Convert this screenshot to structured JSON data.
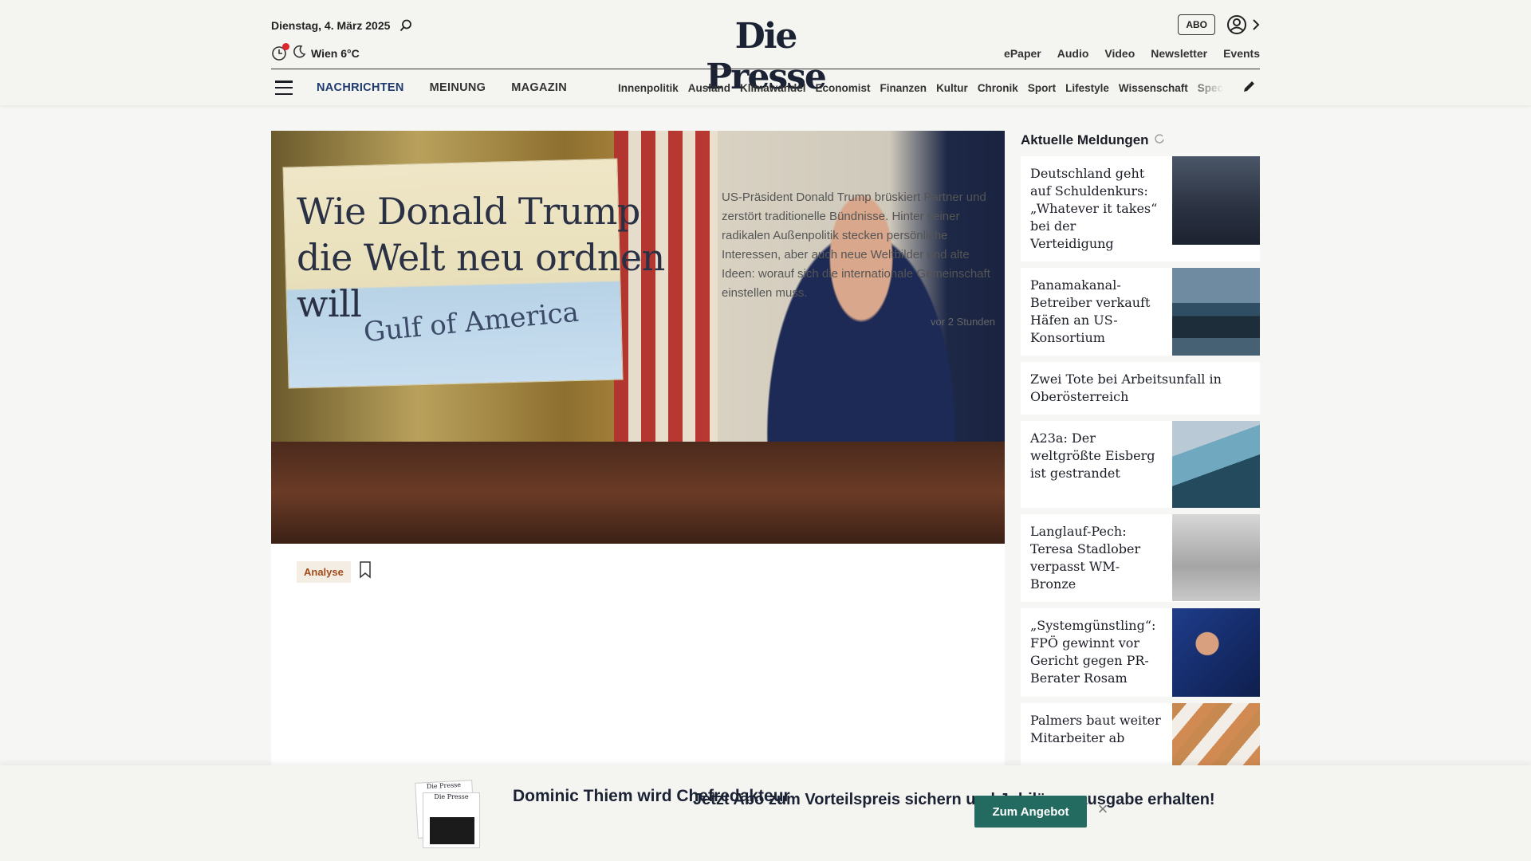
{
  "header": {
    "date": "Dienstag, 4. März 2025",
    "weather": "Wien 6°C",
    "logo": "Die Presse",
    "abo": "ABO",
    "links": [
      "ePaper",
      "Audio",
      "Video",
      "Newsletter",
      "Events"
    ]
  },
  "nav": {
    "main": [
      "NACHRICHTEN",
      "MEINUNG",
      "MAGAZIN"
    ],
    "sub": [
      "Innenpolitik",
      "Ausland",
      "Klimawandel",
      "Economist",
      "Finanzen",
      "Kultur",
      "Chronik",
      "Sport",
      "Lifestyle",
      "Wissenschaft",
      "Spectrum"
    ]
  },
  "hero": {
    "map_text": "Gulf of America",
    "tag": "Analyse",
    "title": "Wie Donald Trump die Welt neu ordnen will",
    "teaser": "US-Präsident Donald Trump brüskiert Partner und zerstört traditionelle Bündnisse. Hinter seiner radikalen Außenpolitik stecken persönliche Interessen, aber auch neue Weltbilder und alte Ideen: worauf sich die internationale Gemeinschaft einstellen muss.",
    "time": "vor 2 Stunden"
  },
  "sidebar": {
    "heading": "Aktuelle Meldungen",
    "items": [
      {
        "title": "Deutschland geht auf Schuldenkurs: „Whatever it takes“ bei der Verteidigung"
      },
      {
        "title": "Panamakanal-Betreiber verkauft Häfen an US-Konsortium"
      },
      {
        "title": "Zwei Tote bei Arbeitsunfall in Oberösterreich"
      },
      {
        "title": "A23a: Der weltgrößte Eisberg ist gestrandet"
      },
      {
        "title": "Langlauf-Pech: Teresa Stadlober verpasst WM-Bronze"
      },
      {
        "title": "„Systemgünstling“: FPÖ gewinnt vor Gericht gegen PR-Berater Rosam"
      },
      {
        "title": "Palmers baut weiter Mitarbeiter ab"
      }
    ]
  },
  "promo": {
    "headline": "Dominic Thiem wird Chefredakteur",
    "text": "Jetzt Abo zum Vorteilspreis sichern und Jubiläumsausgabe erhalten!",
    "button": "Zum Angebot",
    "paper_logo": "Die Presse"
  },
  "colors": {
    "accent": "#1e3a6e",
    "button": "#236b60",
    "tag_text": "#a24c18",
    "notification": "#e0262d"
  }
}
